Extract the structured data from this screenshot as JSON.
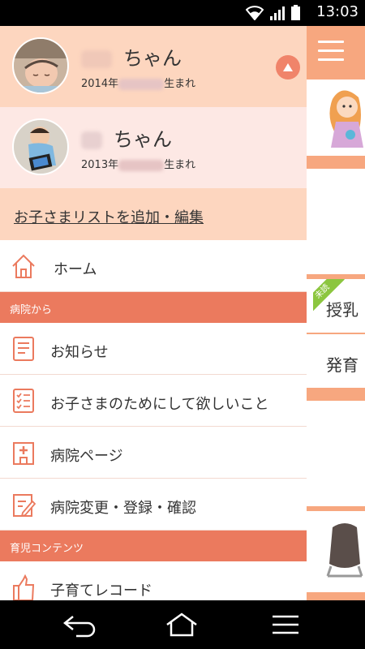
{
  "status_bar": {
    "time": "13:03"
  },
  "children": [
    {
      "name_suffix": "ちゃん",
      "birth_prefix": "2014年",
      "birth_suffix": "生まれ"
    },
    {
      "name_suffix": "ちゃん",
      "birth_prefix": "2013年",
      "birth_suffix": "生まれ"
    }
  ],
  "add_edit_label": "お子さまリストを追加・編集",
  "home_label": "ホーム",
  "sections": [
    {
      "title": "病院から",
      "items": [
        "お知らせ",
        "お子さまのためにして欲しいこと",
        "病院ページ",
        "病院変更・登録・確認"
      ]
    },
    {
      "title": "育児コンテンツ",
      "items": [
        "子育てレコード"
      ]
    }
  ],
  "background_page": {
    "badge": "未読",
    "labels": [
      "授乳",
      "発育"
    ]
  },
  "colors": {
    "accent": "#eb7a5e",
    "child1_bg": "#fdd6bf",
    "child2_bg": "#fde8e4",
    "strip": "#f7a77f"
  },
  "icons": [
    "wifi-icon",
    "signal-icon",
    "battery-icon",
    "home-icon",
    "news-icon",
    "checklist-icon",
    "hospital-icon",
    "edit-icon",
    "thumbs-up-icon",
    "back-icon",
    "nav-home-icon",
    "menu-icon"
  ]
}
